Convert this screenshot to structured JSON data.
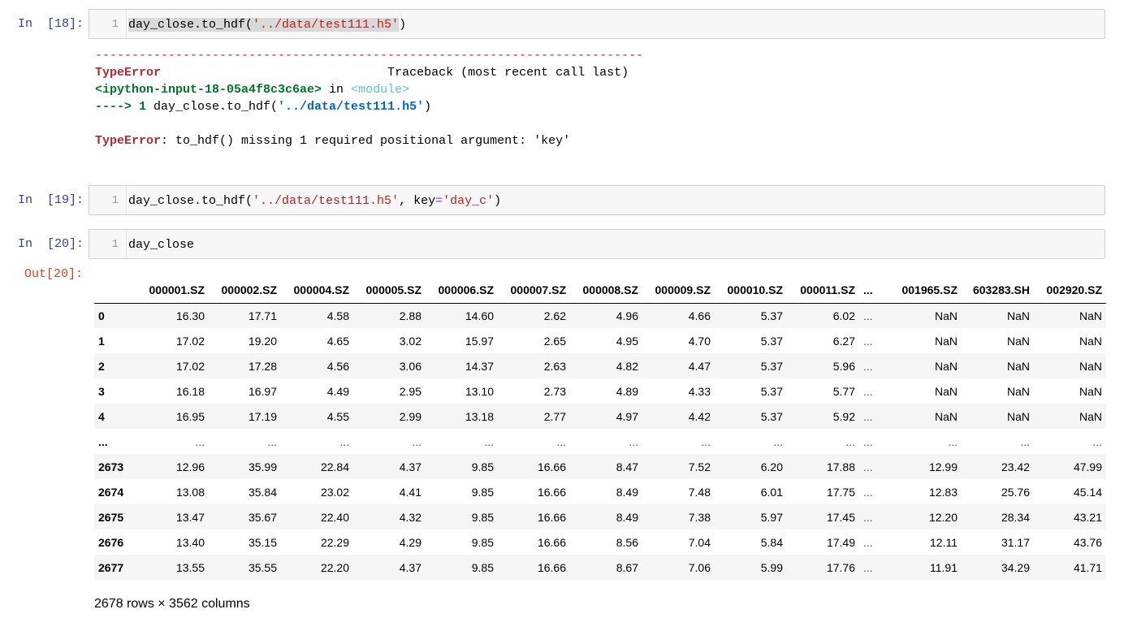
{
  "cells": [
    {
      "prompt": "In  [18]:",
      "line_number": "1",
      "code_plain_1": "day_close.to_hdf(",
      "code_str_1": "'../data/test111.h5'",
      "code_plain_2": ")"
    },
    {
      "prompt": "In  [19]:",
      "line_number": "1",
      "code_plain_1": "day_close.to_hdf(",
      "code_str_1": "'../data/test111.h5'",
      "code_plain_2": ", key",
      "code_op": "=",
      "code_str_2": "'day_c'",
      "code_plain_3": ")"
    },
    {
      "prompt": "In  [20]:",
      "line_number": "1",
      "code_plain_1": "day_close"
    }
  ],
  "error": {
    "dashes": "---------------------------------------------------------------------------",
    "type": "TypeError",
    "traceback_title": "                               Traceback (most recent call last)",
    "input_ref": "<ipython-input-18-05a4f8c3c6ae>",
    "in_word": " in ",
    "module": "<module>",
    "arrow": "----> 1 ",
    "arrow_code": "day_close.to_hdf(",
    "arrow_str": "'../data/test111.h5'",
    "arrow_close": ")",
    "message_type": "TypeError",
    "message": ": to_hdf() missing 1 required positional argument: 'key'"
  },
  "output": {
    "prompt": "Out[20]:",
    "columns": [
      "",
      "000001.SZ",
      "000002.SZ",
      "000004.SZ",
      "000005.SZ",
      "000006.SZ",
      "000007.SZ",
      "000008.SZ",
      "000009.SZ",
      "000010.SZ",
      "000011.SZ",
      "...",
      "001965.SZ",
      "603283.SH",
      "002920.SZ"
    ],
    "rows": [
      [
        "0",
        "16.30",
        "17.71",
        "4.58",
        "2.88",
        "14.60",
        "2.62",
        "4.96",
        "4.66",
        "5.37",
        "6.02",
        "...",
        "NaN",
        "NaN",
        "NaN"
      ],
      [
        "1",
        "17.02",
        "19.20",
        "4.65",
        "3.02",
        "15.97",
        "2.65",
        "4.95",
        "4.70",
        "5.37",
        "6.27",
        "...",
        "NaN",
        "NaN",
        "NaN"
      ],
      [
        "2",
        "17.02",
        "17.28",
        "4.56",
        "3.06",
        "14.37",
        "2.63",
        "4.82",
        "4.47",
        "5.37",
        "5.96",
        "...",
        "NaN",
        "NaN",
        "NaN"
      ],
      [
        "3",
        "16.18",
        "16.97",
        "4.49",
        "2.95",
        "13.10",
        "2.73",
        "4.89",
        "4.33",
        "5.37",
        "5.77",
        "...",
        "NaN",
        "NaN",
        "NaN"
      ],
      [
        "4",
        "16.95",
        "17.19",
        "4.55",
        "2.99",
        "13.18",
        "2.77",
        "4.97",
        "4.42",
        "5.37",
        "5.92",
        "...",
        "NaN",
        "NaN",
        "NaN"
      ],
      [
        "...",
        "...",
        "...",
        "...",
        "...",
        "...",
        "...",
        "...",
        "...",
        "...",
        "...",
        "...",
        "...",
        "...",
        "..."
      ],
      [
        "2673",
        "12.96",
        "35.99",
        "22.84",
        "4.37",
        "9.85",
        "16.66",
        "8.47",
        "7.52",
        "6.20",
        "17.88",
        "...",
        "12.99",
        "23.42",
        "47.99"
      ],
      [
        "2674",
        "13.08",
        "35.84",
        "23.02",
        "4.41",
        "9.85",
        "16.66",
        "8.49",
        "7.48",
        "6.01",
        "17.75",
        "...",
        "12.83",
        "25.76",
        "45.14"
      ],
      [
        "2675",
        "13.47",
        "35.67",
        "22.40",
        "4.32",
        "9.85",
        "16.66",
        "8.49",
        "7.38",
        "5.97",
        "17.45",
        "...",
        "12.20",
        "28.34",
        "43.21"
      ],
      [
        "2676",
        "13.40",
        "35.15",
        "22.29",
        "4.29",
        "9.85",
        "16.66",
        "8.56",
        "7.04",
        "5.84",
        "17.49",
        "...",
        "12.11",
        "31.17",
        "43.76"
      ],
      [
        "2677",
        "13.55",
        "35.55",
        "22.20",
        "4.37",
        "9.85",
        "16.66",
        "8.67",
        "7.06",
        "5.99",
        "17.76",
        "...",
        "11.91",
        "34.29",
        "41.71"
      ]
    ],
    "shape": "2678 rows × 3562 columns"
  }
}
